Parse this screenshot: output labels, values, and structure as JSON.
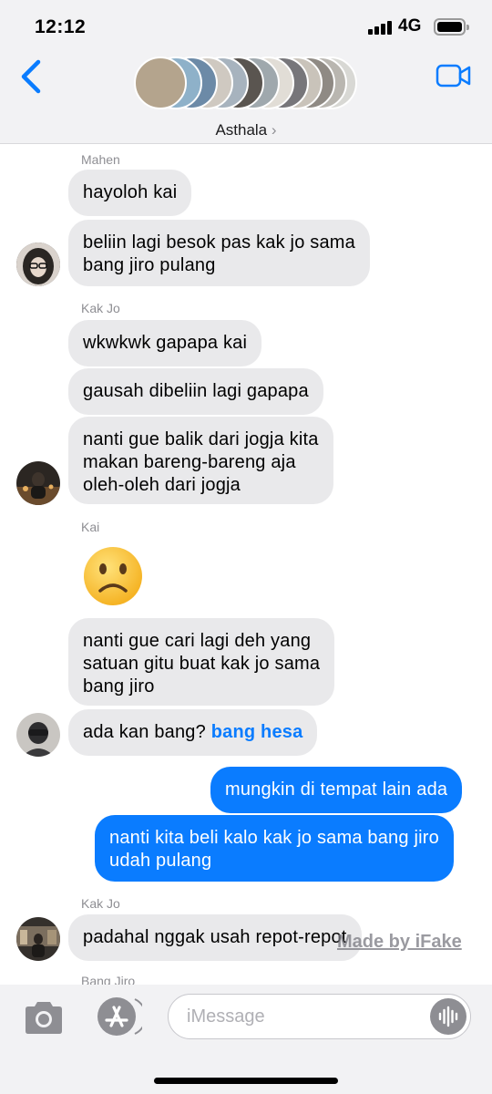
{
  "status_bar": {
    "time": "12:12",
    "network": "4G"
  },
  "header": {
    "group_name": "Asthala",
    "chevron": "›"
  },
  "colors": {
    "accent": "#0a7cff",
    "incoming_bubble": "#e9e9eb",
    "outgoing_bubble": "#0a7cff"
  },
  "messages": [
    {
      "type": "sender",
      "text": "Mahen"
    },
    {
      "type": "in",
      "lines": [
        "hayoloh kai"
      ]
    },
    {
      "type": "in",
      "lines": [
        "beliin lagi besok pas kak jo sama",
        "bang jiro pulang"
      ]
    },
    {
      "type": "sender",
      "text": "Kak Jo"
    },
    {
      "type": "in",
      "lines": [
        "wkwkwk gapapa kai"
      ]
    },
    {
      "type": "in",
      "lines": [
        "gausah dibeliin lagi gapapa"
      ]
    },
    {
      "type": "in",
      "lines": [
        "nanti gue balik dari jogja kita",
        "makan bareng-bareng aja",
        "oleh-oleh dari jogja"
      ]
    },
    {
      "type": "sender",
      "text": "Kai"
    },
    {
      "type": "emoji",
      "name": "slightly-frowning-face"
    },
    {
      "type": "in",
      "lines": [
        "nanti gue cari lagi deh yang",
        "satuan gitu buat kak jo sama",
        "bang jiro"
      ]
    },
    {
      "type": "in",
      "text": "ada kan bang?",
      "mention": "bang hesa"
    },
    {
      "type": "out",
      "lines": [
        "mungkin di tempat lain ada"
      ]
    },
    {
      "type": "out",
      "lines": [
        "nanti kita beli kalo kak jo sama bang jiro",
        "udah pulang"
      ]
    },
    {
      "type": "sender",
      "text": "Kak Jo"
    },
    {
      "type": "in",
      "lines": [
        "padahal nggak usah repot-repot"
      ]
    },
    {
      "type": "sender",
      "text": "Bang Jiro"
    }
  ],
  "watermark": "Made by iFake",
  "input": {
    "placeholder": "iMessage"
  },
  "icons": [
    "back-chevron-icon",
    "video-camera-icon",
    "camera-icon",
    "app-store-icon",
    "audio-waveform-icon"
  ]
}
